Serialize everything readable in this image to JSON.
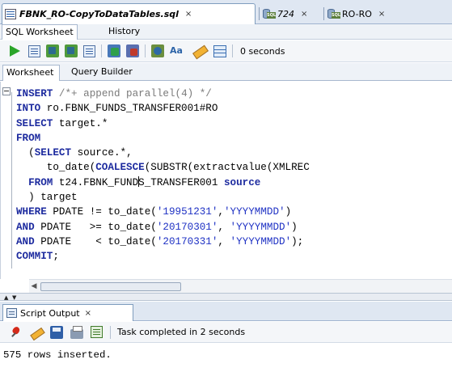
{
  "document_tabs": [
    {
      "label": "FBNK_RO-CopyToDataTables.sql",
      "close": "×",
      "icon": "sql-file-icon",
      "active": true
    },
    {
      "label": "724",
      "close": "×",
      "icon": "database-sql-icon",
      "active": false
    },
    {
      "label": "RO-RO",
      "close": "×",
      "icon": "database-sql-icon",
      "active": false
    }
  ],
  "sub_tabs": {
    "worksheet": "SQL Worksheet",
    "history": "History"
  },
  "toolbar": {
    "elapsed": "0 seconds",
    "icons": [
      "run-statement-icon",
      "run-script-icon",
      "commit-icon",
      "rollback-icon",
      "explain-plan-icon",
      "autotrace-icon",
      "sql-tuning-icon",
      "uppercase-icon",
      "clear-icon",
      "history-icon"
    ]
  },
  "inner_tabs": {
    "worksheet": "Worksheet",
    "query_builder": "Query Builder"
  },
  "editor": {
    "lines": [
      "INSERT /*+ append parallel(4) */",
      "INTO ro.FBNK_FUNDS_TRANSFER001#RO",
      "SELECT target.*",
      "FROM",
      "  (SELECT source.*,",
      "     to_date(COALESCE(SUBSTR(extractvalue(XMLREC",
      "  FROM t24.FBNK_FUNDS_TRANSFER001 source",
      "  ) target",
      "WHERE PDATE != to_date('19951231','YYYYMMDD')",
      "AND PDATE   >= to_date('20170301', 'YYYYMMDD')",
      "AND PDATE    < to_date('20170331', 'YYYYMMDD');",
      "COMMIT;"
    ]
  },
  "output_panel": {
    "tab_label": "Script Output",
    "close": "×",
    "task_status": "Task completed in 2 seconds",
    "output_text": "575 rows inserted."
  }
}
